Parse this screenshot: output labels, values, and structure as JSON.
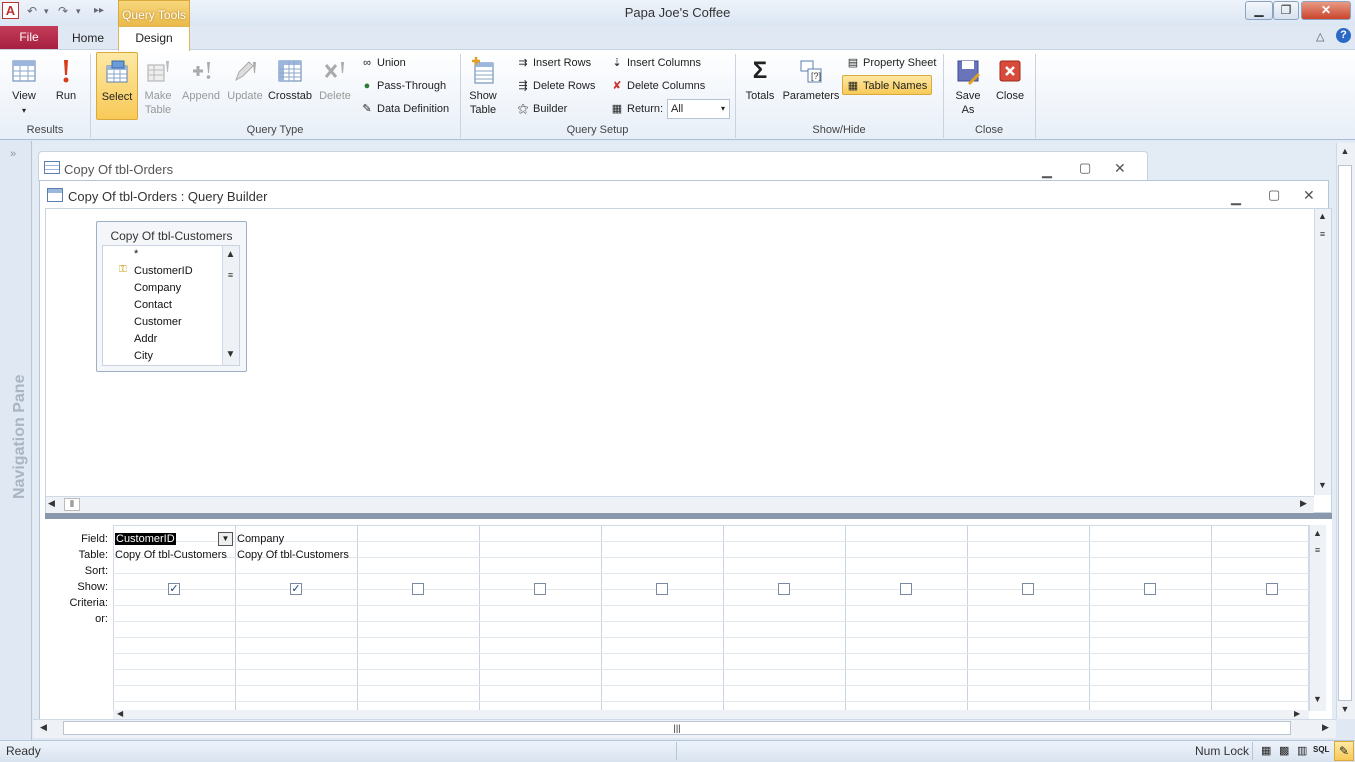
{
  "app": {
    "icon_letter": "A",
    "title": "Papa Joe's Coffee",
    "context_tab": "Query Tools",
    "tabs": [
      "File",
      "Home",
      "Design"
    ]
  },
  "ribbon": {
    "results": {
      "label": "Results",
      "view": "View",
      "run": "Run"
    },
    "query_type": {
      "label": "Query Type",
      "select": "Select",
      "make_table": "Make Table",
      "append": "Append",
      "update": "Update",
      "crosstab": "Crosstab",
      "delete": "Delete",
      "union": "Union",
      "pass_through": "Pass-Through",
      "data_definition": "Data Definition"
    },
    "query_setup": {
      "label": "Query Setup",
      "show_table": "Show Table",
      "insert_rows": "Insert Rows",
      "delete_rows": "Delete Rows",
      "builder": "Builder",
      "insert_columns": "Insert Columns",
      "delete_columns": "Delete Columns",
      "return_label": "Return:",
      "return_value": "All"
    },
    "show_hide": {
      "label": "Show/Hide",
      "totals": "Totals",
      "parameters": "Parameters",
      "property_sheet": "Property Sheet",
      "table_names": "Table Names"
    },
    "close": {
      "label": "Close",
      "save_as": "Save As",
      "close": "Close"
    }
  },
  "nav_pane": {
    "label": "Navigation Pane"
  },
  "windows": {
    "outer_title": "Copy Of tbl-Orders",
    "builder_title": "Copy Of tbl-Orders : Query Builder"
  },
  "table_box": {
    "title": "Copy Of tbl-Customers",
    "fields": [
      "*",
      "CustomerID",
      "Company",
      "Contact",
      "Customer",
      "Addr",
      "City"
    ],
    "primary_key": "CustomerID"
  },
  "design_grid": {
    "row_labels": [
      "Field:",
      "Table:",
      "Sort:",
      "Show:",
      "Criteria:",
      "or:"
    ],
    "columns": [
      {
        "field": "CustomerID",
        "table": "Copy Of tbl-Customers",
        "show": true
      },
      {
        "field": "Company",
        "table": "Copy Of tbl-Customers",
        "show": true
      },
      {
        "field": "",
        "table": "",
        "show": false
      },
      {
        "field": "",
        "table": "",
        "show": false
      },
      {
        "field": "",
        "table": "",
        "show": false
      },
      {
        "field": "",
        "table": "",
        "show": false
      },
      {
        "field": "",
        "table": "",
        "show": false
      },
      {
        "field": "",
        "table": "",
        "show": false
      },
      {
        "field": "",
        "table": "",
        "show": false
      },
      {
        "field": "",
        "table": "",
        "show": false
      }
    ]
  },
  "status": {
    "left": "Ready",
    "num_lock": "Num Lock",
    "sql": "SQL"
  },
  "colors": {
    "accent": "#f8c957",
    "file_tab": "#a71f3f",
    "ribbon_bg": "#e8eff8"
  }
}
